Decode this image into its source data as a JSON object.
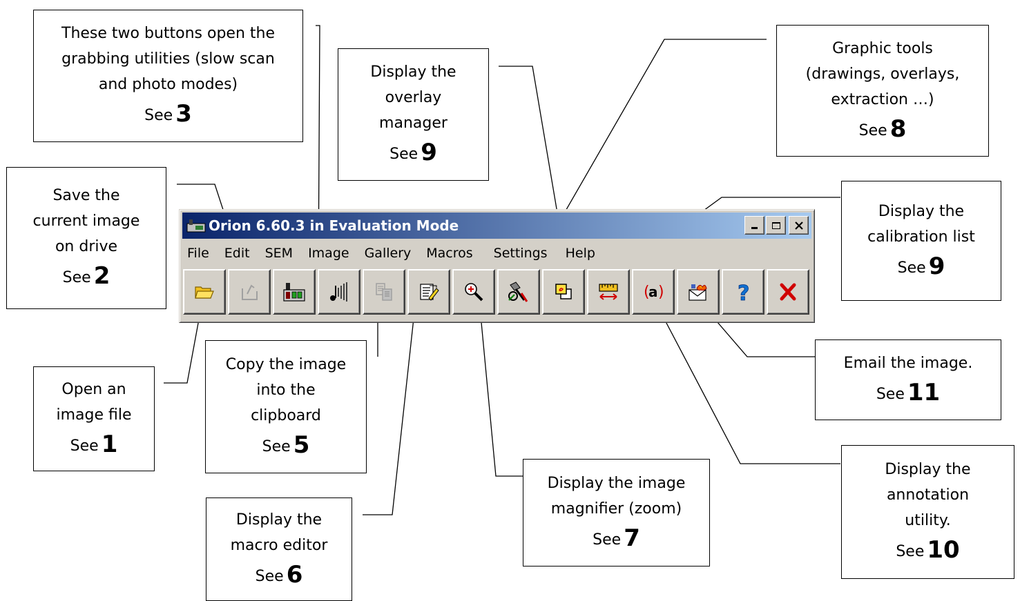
{
  "window": {
    "title": "Orion 6.60.3 in Evaluation Mode",
    "menu": [
      "File",
      "Edit",
      "SEM",
      "Image",
      "Gallery",
      "Macros",
      "Settings",
      "Help"
    ]
  },
  "toolbar": {
    "buttons": [
      {
        "icon": "open-folder-icon",
        "enabled": true
      },
      {
        "icon": "save-icon",
        "enabled": false
      },
      {
        "icon": "slow-scan-grab-icon",
        "enabled": true
      },
      {
        "icon": "photo-grab-icon",
        "enabled": true
      },
      {
        "icon": "copy-clipboard-icon",
        "enabled": false
      },
      {
        "icon": "macro-editor-icon",
        "enabled": true
      },
      {
        "icon": "magnifier-icon",
        "enabled": true
      },
      {
        "icon": "graphic-tools-icon",
        "enabled": true
      },
      {
        "icon": "overlay-manager-icon",
        "enabled": true
      },
      {
        "icon": "calibration-list-icon",
        "enabled": true
      },
      {
        "icon": "annotation-icon",
        "enabled": true
      },
      {
        "icon": "email-icon",
        "enabled": true
      },
      {
        "icon": "help-icon",
        "enabled": true
      },
      {
        "icon": "close-icon",
        "enabled": true
      }
    ]
  },
  "callouts": {
    "grab": {
      "lines": [
        "These two buttons open the",
        "grabbing utilities (slow scan",
        "and photo modes)"
      ],
      "see": "See",
      "num": "3"
    },
    "save": {
      "lines": [
        "Save the",
        "current image",
        "on drive"
      ],
      "see": "See",
      "num": "2"
    },
    "open": {
      "lines": [
        "Open an",
        "image file"
      ],
      "see": "See",
      "num": "1"
    },
    "copy": {
      "lines": [
        "Copy the image",
        "into the",
        "clipboard"
      ],
      "see": "See",
      "num": "5"
    },
    "macro": {
      "lines": [
        "Display the",
        "macro editor"
      ],
      "see": "See",
      "num": "6"
    },
    "overlay": {
      "lines": [
        "Display the",
        "overlay",
        "manager"
      ],
      "see": "See",
      "num": "9"
    },
    "zoom": {
      "lines": [
        "Display the image",
        "magnifier (zoom)"
      ],
      "see": "See",
      "num": "7"
    },
    "graphic": {
      "lines": [
        "Graphic tools",
        "(drawings, overlays,",
        "extraction …)"
      ],
      "see": "See",
      "num": "8"
    },
    "calibration": {
      "lines": [
        "Display the",
        "calibration list"
      ],
      "see": "See",
      "num": "9"
    },
    "email": {
      "lines": [
        "Email the image."
      ],
      "see": "See",
      "num": "11"
    },
    "annotation": {
      "lines": [
        "Display the",
        "annotation",
        "utility."
      ],
      "see": "See",
      "num": "10"
    }
  }
}
